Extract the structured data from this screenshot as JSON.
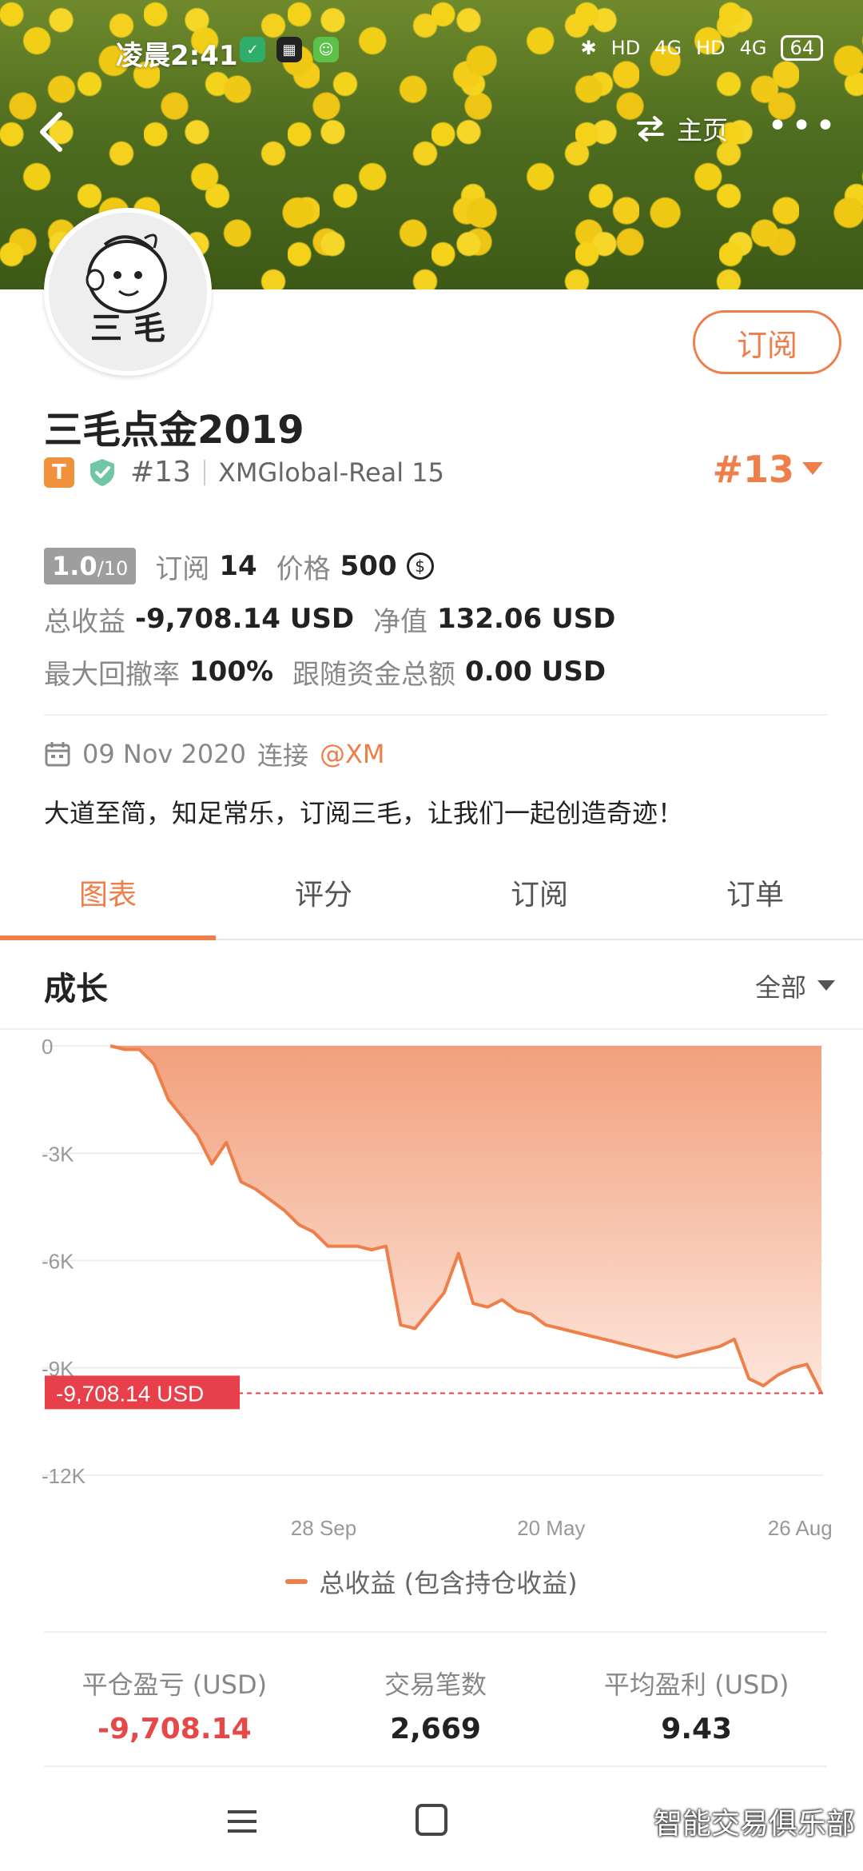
{
  "status_bar": {
    "time": "凌晨2:41",
    "signal_1": "4G",
    "signal_2": "4G",
    "hd_1": "HD",
    "hd_2": "HD",
    "battery": "64"
  },
  "nav": {
    "home_label": "主页"
  },
  "profile": {
    "name": "三毛点金2019",
    "subscribe_label": "订阅",
    "rank_badge": "#13",
    "server": "XMGlobal-Real 15",
    "rank_right": "#13",
    "tier_badge": "T",
    "avatar_text": "三 毛"
  },
  "stats": {
    "score": "1.0",
    "score_max": "/10",
    "subscribers_label": "订阅",
    "subscribers": "14",
    "price_label": "价格",
    "price": "500",
    "total_profit_label": "总收益",
    "total_profit": "-9,708.14 USD",
    "equity_label": "净值",
    "equity": "132.06 USD",
    "max_drawdown_label": "最大回撤率",
    "max_drawdown": "100%",
    "follow_funds_label": "跟随资金总额",
    "follow_funds": "0.00 USD"
  },
  "connect": {
    "date": "09 Nov 2020",
    "connect_label": "连接",
    "broker": "@XM"
  },
  "bio": "大道至简，知足常乐，订阅三毛，让我们一起创造奇迹！",
  "tabs": [
    "图表",
    "评分",
    "订阅",
    "订单"
  ],
  "section": {
    "title": "成长",
    "filter": "全部"
  },
  "chart_data": {
    "type": "area",
    "y_ticks": [
      "0",
      "-3K",
      "-6K",
      "-9K",
      "-12K"
    ],
    "x_ticks": [
      "28 Sep",
      "20 May",
      "26 Aug"
    ],
    "ylim": [
      -12000,
      0
    ],
    "current_value_label": "-9,708.14 USD",
    "current_value": -9708.14,
    "series": [
      {
        "name": "总收益 (包含持仓收益)",
        "color": "#ee7e4a",
        "values": [
          0,
          -100,
          -100,
          -500,
          -1500,
          -2000,
          -2500,
          -3300,
          -2700,
          -3800,
          -4000,
          -4300,
          -4600,
          -5000,
          -5200,
          -5600,
          -5600,
          -5600,
          -5700,
          -5600,
          -7800,
          -7900,
          -7400,
          -6900,
          -5800,
          -7200,
          -7300,
          -7100,
          -7400,
          -7500,
          -7800,
          -7900,
          -8000,
          -8100,
          -8200,
          -8300,
          -8400,
          -8500,
          -8600,
          -8700,
          -8600,
          -8500,
          -8400,
          -8200,
          -9300,
          -9500,
          -9200,
          -9000,
          -8900,
          -9708.14
        ]
      }
    ]
  },
  "summary": [
    {
      "label": "平仓盈亏 (USD)",
      "value": "-9,708.14"
    },
    {
      "label": "交易笔数",
      "value": "2,669"
    },
    {
      "label": "平均盈利 (USD)",
      "value": "9.43"
    }
  ],
  "watermark": "智能交易俱乐部",
  "colors": {
    "accent": "#ee7e4a",
    "negative": "#e64848",
    "label_bg": "#e8404a"
  }
}
